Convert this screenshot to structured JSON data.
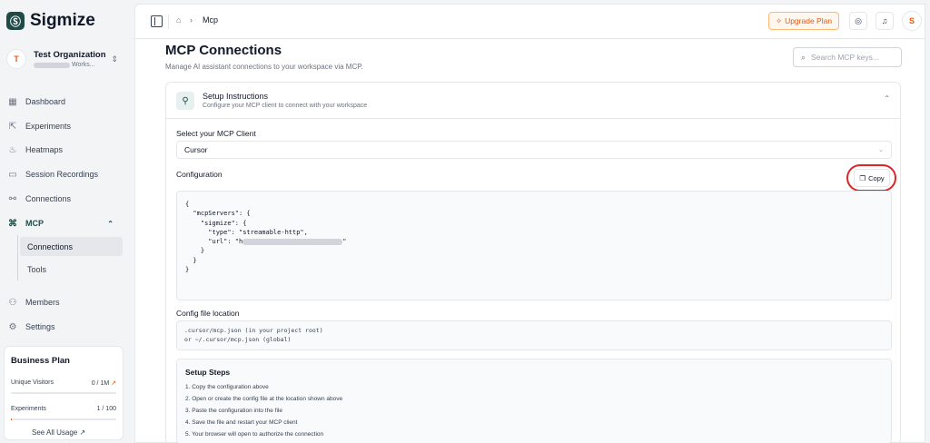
{
  "brand": {
    "logo": "Ⓢ",
    "name": "Sigmize"
  },
  "org": {
    "avatar": "T",
    "name": "Test Organization",
    "sub": "Works..."
  },
  "nav": {
    "dashboard": "Dashboard",
    "experiments": "Experiments",
    "heatmaps": "Heatmaps",
    "recordings": "Session Recordings",
    "connections": "Connections",
    "mcp": "MCP",
    "mcp_connections": "Connections",
    "mcp_tools": "Tools",
    "members": "Members",
    "settings": "Settings"
  },
  "plan": {
    "title": "Business Plan",
    "visitors_label": "Unique Visitors",
    "visitors_value": "0 / 1M",
    "visitors_fraction": 0.0,
    "experiments_label": "Experiments",
    "experiments_value": "1 / 100",
    "experiments_fraction": 0.01,
    "link": "See All Usage"
  },
  "topbar": {
    "breadcrumb_current": "Mcp",
    "upgrade": "Upgrade Plan",
    "user_initial": "S"
  },
  "page": {
    "title": "MCP Connections",
    "subtitle": "Manage AI assistant connections to your workspace via MCP.",
    "search_placeholder": "Search MCP keys..."
  },
  "setup": {
    "title": "Setup Instructions",
    "subtitle": "Configure your MCP client to connect with your workspace",
    "client_label": "Select your MCP Client",
    "client_value": "Cursor",
    "config_label": "Configuration",
    "copy": "Copy",
    "code_lines": [
      "{",
      "  \"mcpServers\": {",
      "    \"sigmize\": {",
      "      \"type\": \"streamable-http\",",
      "      \"url\": \"h",
      "    }",
      "  }",
      "}"
    ],
    "location_label": "Config file location",
    "location_lines": [
      ".cursor/mcp.json (in your project root)",
      "or ~/.cursor/mcp.json (global)"
    ],
    "steps_title": "Setup Steps",
    "steps": [
      "1. Copy the configuration above",
      "2. Open or create the config file at the location shown above",
      "3. Paste the configuration into the file",
      "4. Save the file and restart your MCP client",
      "5. Your browser will open to authorize the connection"
    ]
  }
}
